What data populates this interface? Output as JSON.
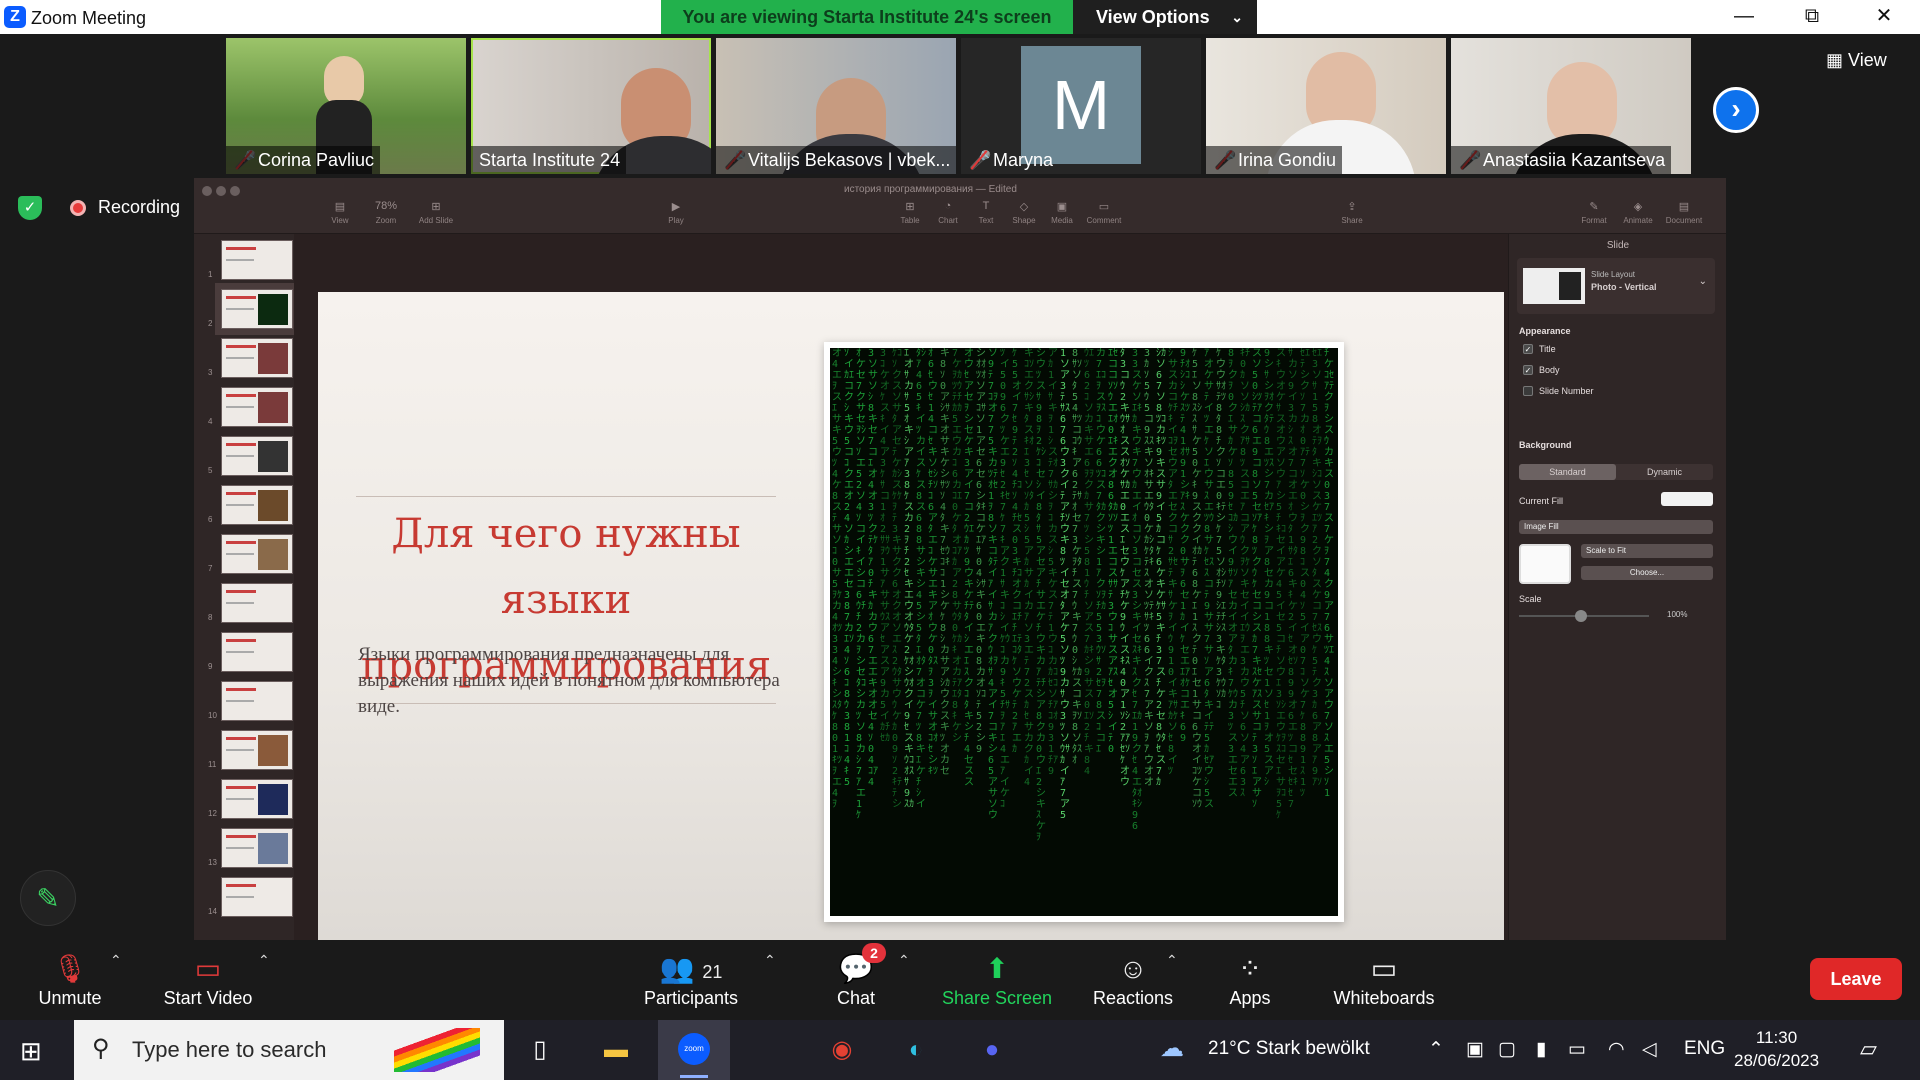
{
  "window": {
    "title": "Zoom Meeting",
    "viewing_banner": "You are viewing Starta Institute 24's screen",
    "view_options": "View Options",
    "minimize": "—",
    "restore": "⧉",
    "close": "✕"
  },
  "gallery": {
    "participants": [
      {
        "name": "Corina Pavliuc",
        "muted": true
      },
      {
        "name": "Starta Institute 24",
        "muted": false,
        "active": true
      },
      {
        "name": "Vitalijs Bekasovs | vbek...",
        "muted": true
      },
      {
        "name": "Maryna",
        "muted": true,
        "avatar_letter": "M"
      },
      {
        "name": "Irina Gondiu",
        "muted": true
      },
      {
        "name": "Anastasiia Kazantseva",
        "muted": true
      }
    ],
    "view_label": "View"
  },
  "recording": {
    "label": "Recording"
  },
  "keynote": {
    "doc_title": "история программирования — Edited",
    "toolbar": {
      "view": "View",
      "zoom": "Zoom",
      "zoom_value": "78%",
      "add_slide": "Add Slide",
      "play": "Play",
      "table": "Table",
      "chart": "Chart",
      "text": "Text",
      "shape": "Shape",
      "media": "Media",
      "comment": "Comment",
      "share": "Share",
      "format": "Format",
      "animate": "Animate",
      "document": "Document"
    },
    "slide_numbers": [
      "1",
      "2",
      "3",
      "4",
      "5",
      "6",
      "7",
      "8",
      "9",
      "10",
      "11",
      "12",
      "13",
      "14"
    ],
    "slide": {
      "title": "Для чего нужны языки программирования",
      "body": "Языки программирования предназначены для выражения наших идей в понятном для компьютера виде."
    },
    "inspector": {
      "tab": "Slide",
      "layout_label": "Slide Layout",
      "layout_value": "Photo - Vertical",
      "appearance": "Appearance",
      "chk_title": "Title",
      "chk_body": "Body",
      "chk_slide_number": "Slide Number",
      "background": "Background",
      "standard": "Standard",
      "dynamic": "Dynamic",
      "current_fill": "Current Fill",
      "image_fill": "Image Fill",
      "scale_to_fit": "Scale to Fit",
      "choose": "Choose...",
      "scale": "Scale",
      "scale_value": "100%"
    }
  },
  "toolbar": {
    "unmute": "Unmute",
    "start_video": "Start Video",
    "participants": "Participants",
    "participants_count": "21",
    "chat": "Chat",
    "chat_badge": "2",
    "share_screen": "Share Screen",
    "reactions": "Reactions",
    "apps": "Apps",
    "whiteboards": "Whiteboards",
    "leave": "Leave"
  },
  "taskbar": {
    "search_placeholder": "Type here to search",
    "zoom_label": "zoom",
    "weather": "21°C  Stark bewölkt",
    "language": "ENG",
    "time": "11:30",
    "date": "28/06/2023"
  },
  "colors": {
    "zoom_blue": "#0b5cff",
    "banner_green": "#22b14c",
    "leave_red": "#e02828",
    "slide_title_red": "#c73a32"
  }
}
